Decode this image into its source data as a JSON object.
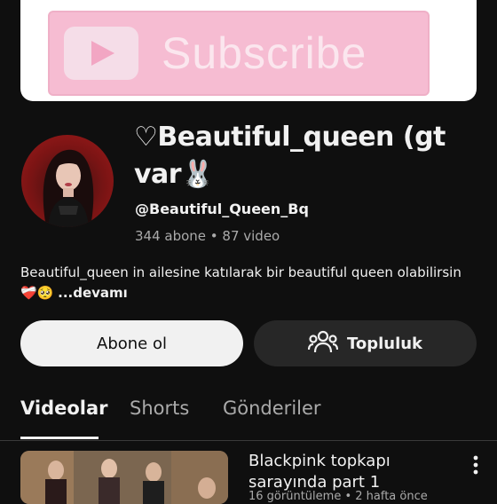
{
  "banner": {
    "subscribe_text": "Subscribe"
  },
  "channel": {
    "name": "♡Beautiful_queen (gt var🐰",
    "handle": "@Beautiful_Queen_Bq",
    "stats": "344 abone • 87 video",
    "description": "Beautiful_queen in ailesine katılarak bir beautiful queen olabilirsin❤️‍🩹🥺 ",
    "more_label": "...devamı"
  },
  "actions": {
    "subscribe_label": "Abone ol",
    "community_label": "Topluluk"
  },
  "tabs": [
    {
      "label": "Videolar",
      "active": true
    },
    {
      "label": "Shorts",
      "active": false
    },
    {
      "label": "Gönderiler",
      "active": false
    }
  ],
  "videos": [
    {
      "title": "Blackpink topkapı sarayında part 1",
      "meta": "16 görüntüleme • 2 hafta önce"
    }
  ],
  "colors": {
    "background": "#0f0f0f",
    "banner_pink": "#f6bcd2",
    "secondary_text": "#aaaaaa"
  }
}
